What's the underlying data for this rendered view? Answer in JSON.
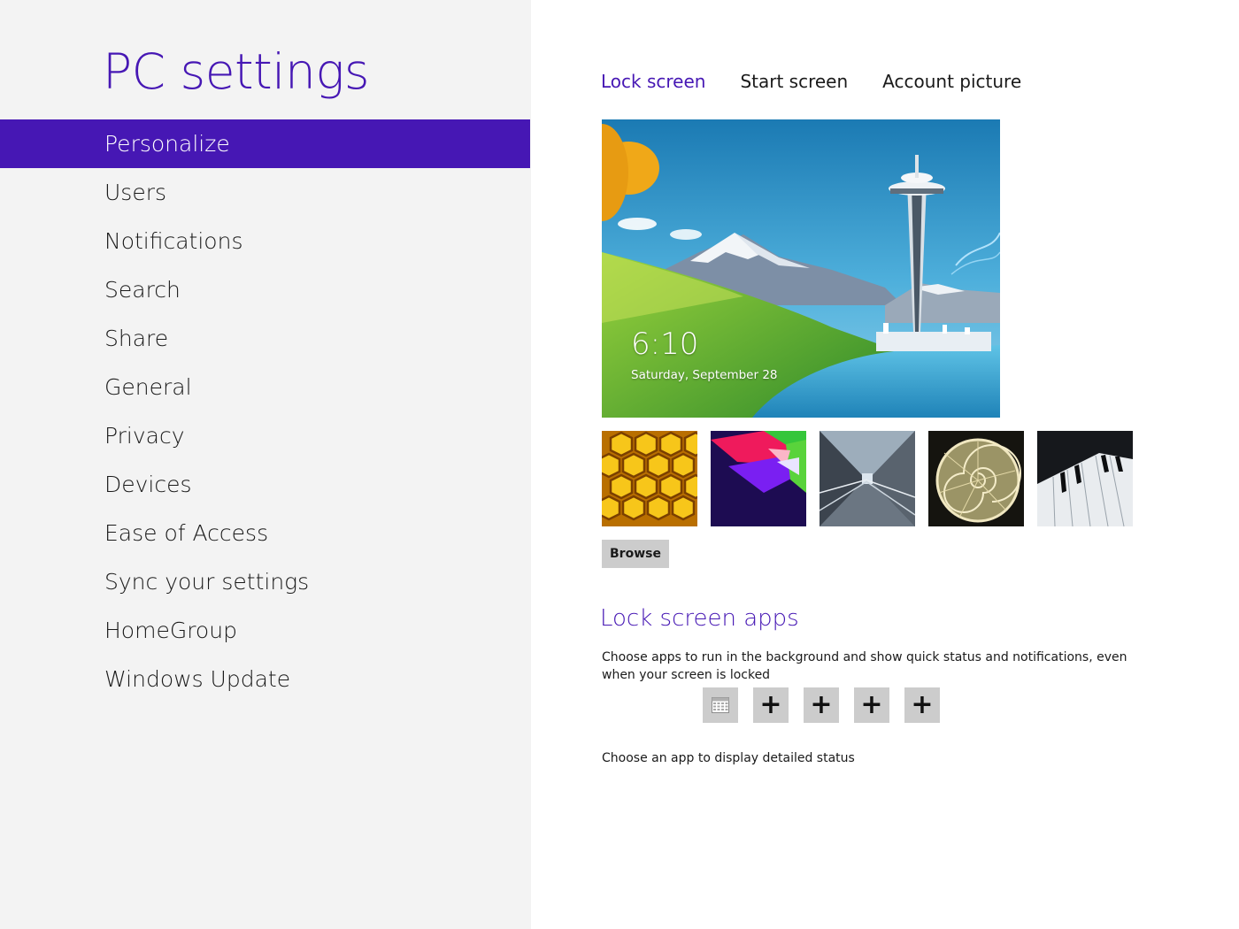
{
  "app": {
    "title": "PC settings"
  },
  "nav": {
    "selected": 0,
    "items": [
      {
        "label": "Personalize"
      },
      {
        "label": "Users"
      },
      {
        "label": "Notifications"
      },
      {
        "label": "Search"
      },
      {
        "label": "Share"
      },
      {
        "label": "General"
      },
      {
        "label": "Privacy"
      },
      {
        "label": "Devices"
      },
      {
        "label": "Ease of Access"
      },
      {
        "label": "Sync your settings"
      },
      {
        "label": "HomeGroup"
      },
      {
        "label": "Windows Update"
      }
    ]
  },
  "tabs": {
    "active": 0,
    "items": [
      {
        "label": "Lock screen"
      },
      {
        "label": "Start screen"
      },
      {
        "label": "Account picture"
      }
    ]
  },
  "preview": {
    "time": "6:10",
    "date": "Saturday, September 28"
  },
  "thumbnails": [
    {
      "subject": "honeycomb"
    },
    {
      "subject": "geometric-shapes"
    },
    {
      "subject": "tunnel"
    },
    {
      "subject": "nautilus-shell"
    },
    {
      "subject": "piano-keys"
    }
  ],
  "browse_label": "Browse",
  "lock_apps": {
    "heading": "Lock screen apps",
    "description": "Choose apps to run in the background and show quick status and notifications, even when your screen is locked",
    "slots": [
      {
        "icon": "calendar-icon"
      },
      {
        "icon": "plus-icon",
        "text": "+"
      },
      {
        "icon": "plus-icon",
        "text": "+"
      },
      {
        "icon": "plus-icon",
        "text": "+"
      },
      {
        "icon": "plus-icon",
        "text": "+"
      }
    ],
    "detail_label": "Choose an app to display detailed status"
  },
  "colors": {
    "accent": "#4617b4",
    "left_pane_bg": "#f3f3f3",
    "button_bg": "#cccccc"
  }
}
